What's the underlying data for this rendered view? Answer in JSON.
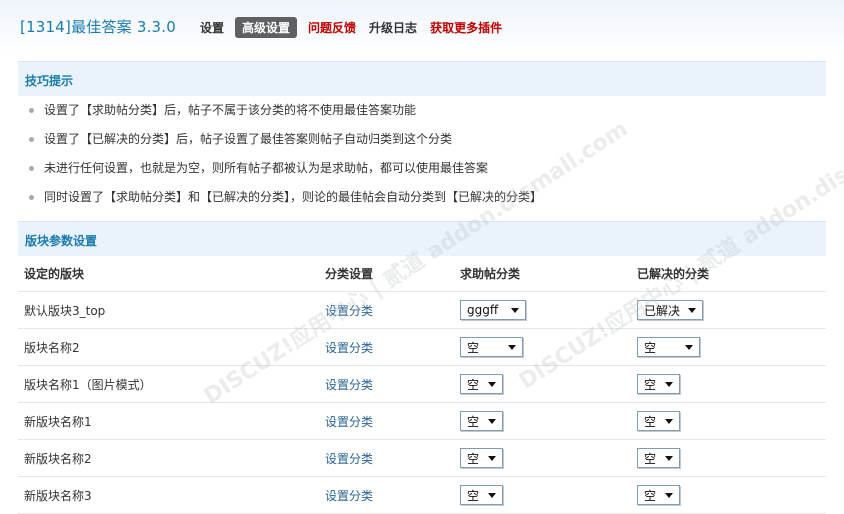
{
  "header": {
    "app_title": "[1314]最佳答案 3.3.0",
    "nav": [
      {
        "label": "设置",
        "style": "normal"
      },
      {
        "label": "高级设置",
        "style": "active"
      },
      {
        "label": "问题反馈",
        "style": "red"
      },
      {
        "label": "升级日志",
        "style": "normal"
      },
      {
        "label": "获取更多插件",
        "style": "red"
      }
    ]
  },
  "tips": {
    "title": "技巧提示",
    "items": [
      "设置了【求助帖分类】后，帖子不属于该分类的将不使用最佳答案功能",
      "设置了【已解决的分类】后，帖子设置了最佳答案则帖子自动归类到这个分类",
      "未进行任何设置，也就是为空，则所有帖子都被认为是求助帖，都可以使用最佳答案",
      "同时设置了【求助帖分类】和【已解决的分类】，则论的最佳帖会自动分类到【已解决的分类】"
    ]
  },
  "forum_settings": {
    "title": "版块参数设置",
    "columns": [
      "设定的版块",
      "分类设置",
      "求助帖分类",
      "已解决的分类"
    ],
    "rows": [
      {
        "forum": "默认版块3_top",
        "action": "设置分类",
        "help_type": "gggff",
        "solved_type": "已解决"
      },
      {
        "forum": "版块名称2",
        "action": "设置分类",
        "help_type": "空",
        "solved_type": "空"
      },
      {
        "forum": "版块名称1（图片模式）",
        "action": "设置分类",
        "help_type": "空",
        "solved_type": "空"
      },
      {
        "forum": "新版块名称1",
        "action": "设置分类",
        "help_type": "空",
        "solved_type": "空"
      },
      {
        "forum": "新版块名称2",
        "action": "设置分类",
        "help_type": "空",
        "solved_type": "空"
      },
      {
        "forum": "新版块名称3",
        "action": "设置分类",
        "help_type": "空",
        "solved_type": "空"
      }
    ]
  },
  "watermark": {
    "text": "DISCUZ!应用中心 | 贰道 addon.dismall.com"
  },
  "colors": {
    "accent": "#1a7cae",
    "section_bg": "#eaf3fc",
    "nav_red": "#c00000",
    "nav_active_bg": "#5e6062",
    "link": "#2a6496"
  }
}
